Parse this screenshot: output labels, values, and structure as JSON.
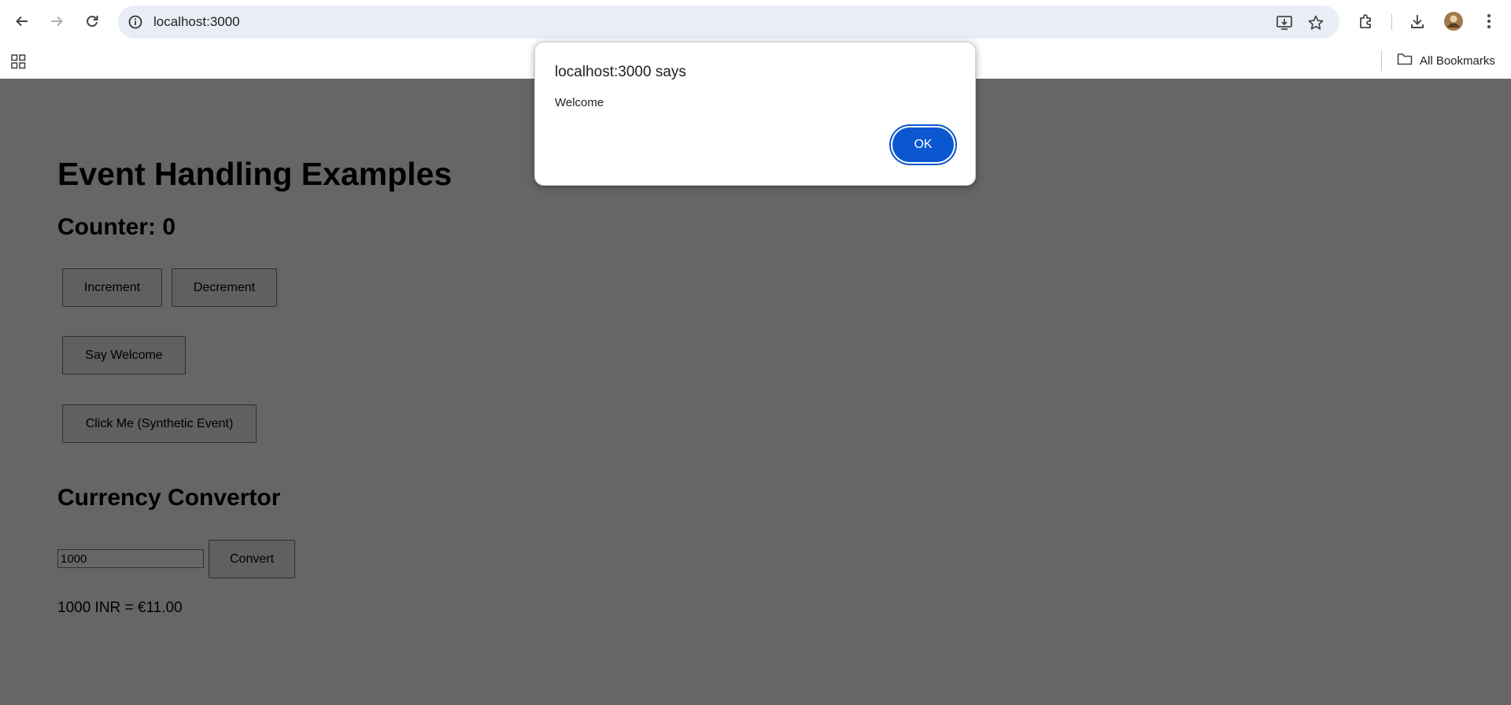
{
  "browser": {
    "url": "localhost:3000",
    "bookmarks_label": "All Bookmarks"
  },
  "page": {
    "title": "Event Handling Examples",
    "counter_label": "Counter: 0",
    "buttons": {
      "increment": "Increment",
      "decrement": "Decrement",
      "say_welcome": "Say Welcome",
      "synthetic": "Click Me (Synthetic Event)"
    },
    "currency": {
      "title": "Currency Convertor",
      "input_value": "1000",
      "convert_label": "Convert",
      "result": "1000 INR = €11.00"
    }
  },
  "dialog": {
    "title": "localhost:3000 says",
    "message": "Welcome",
    "ok_label": "OK"
  },
  "colors": {
    "accent": "#0b57d0",
    "omnibox_bg": "#e9eef6",
    "overlay": "rgba(0,0,0,0.6)"
  }
}
